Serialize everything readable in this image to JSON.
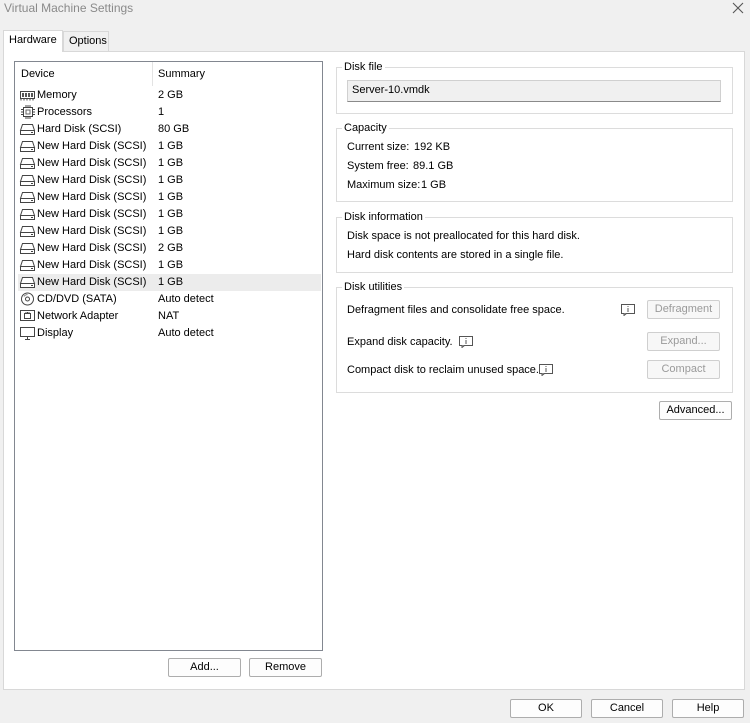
{
  "window": {
    "title": "Virtual Machine Settings"
  },
  "tabs": [
    {
      "label": "Hardware",
      "active": true
    },
    {
      "label": "Options",
      "active": false
    }
  ],
  "device_list": {
    "columns": [
      "Device",
      "Summary"
    ],
    "rows": [
      {
        "icon": "memory-icon",
        "name": "Memory",
        "summary": "2 GB"
      },
      {
        "icon": "processor-icon",
        "name": "Processors",
        "summary": "1"
      },
      {
        "icon": "hard-disk-icon",
        "name": "Hard Disk (SCSI)",
        "summary": "80 GB"
      },
      {
        "icon": "hard-disk-icon",
        "name": "New Hard Disk (SCSI)",
        "summary": "1 GB"
      },
      {
        "icon": "hard-disk-icon",
        "name": "New Hard Disk (SCSI)",
        "summary": "1 GB"
      },
      {
        "icon": "hard-disk-icon",
        "name": "New Hard Disk (SCSI)",
        "summary": "1 GB"
      },
      {
        "icon": "hard-disk-icon",
        "name": "New Hard Disk (SCSI)",
        "summary": "1 GB"
      },
      {
        "icon": "hard-disk-icon",
        "name": "New Hard Disk (SCSI)",
        "summary": "1 GB"
      },
      {
        "icon": "hard-disk-icon",
        "name": "New Hard Disk (SCSI)",
        "summary": "1 GB"
      },
      {
        "icon": "hard-disk-icon",
        "name": "New Hard Disk (SCSI)",
        "summary": "2 GB"
      },
      {
        "icon": "hard-disk-icon",
        "name": "New Hard Disk (SCSI)",
        "summary": "1 GB"
      },
      {
        "icon": "hard-disk-icon",
        "name": "New Hard Disk (SCSI)",
        "summary": "1 GB",
        "selected": true
      },
      {
        "icon": "cd-dvd-icon",
        "name": "CD/DVD (SATA)",
        "summary": "Auto detect"
      },
      {
        "icon": "network-adapter-icon",
        "name": "Network Adapter",
        "summary": "NAT"
      },
      {
        "icon": "display-icon",
        "name": "Display",
        "summary": "Auto detect"
      }
    ],
    "add_label": "Add...",
    "remove_label": "Remove"
  },
  "disk_file": {
    "label": "Disk file",
    "value": "Server-10.vmdk"
  },
  "capacity": {
    "label": "Capacity",
    "current_size_label": "Current size:",
    "current_size": "192 KB",
    "system_free_label": "System free:",
    "system_free": "89.1 GB",
    "maximum_size_label": "Maximum size:",
    "maximum_size": "1 GB"
  },
  "disk_information": {
    "label": "Disk information",
    "line1": "Disk space is not preallocated for this hard disk.",
    "line2": "Hard disk contents are stored in a single file."
  },
  "disk_utilities": {
    "label": "Disk utilities",
    "defragment_text": "Defragment files and consolidate free space.",
    "defragment_button": "Defragment",
    "expand_text": "Expand disk capacity.",
    "expand_button": "Expand...",
    "compact_text": "Compact disk to reclaim unused space.",
    "compact_button": "Compact"
  },
  "advanced_button": "Advanced...",
  "footer": {
    "ok": "OK",
    "cancel": "Cancel",
    "help": "Help"
  }
}
